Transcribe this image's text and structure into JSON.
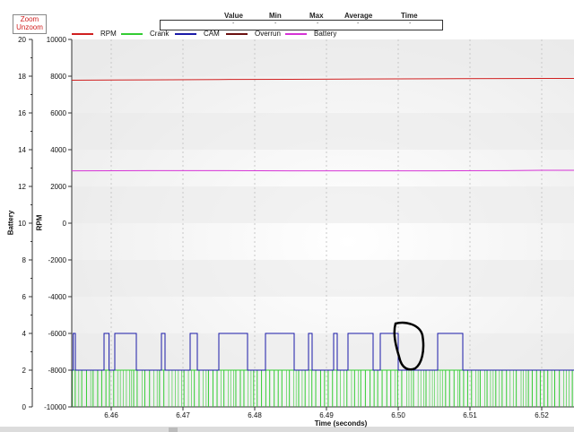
{
  "zoom": {
    "zoom_label": "Zoom",
    "unzoom_label": "Unzoom"
  },
  "stats": {
    "headers": [
      "Value",
      "Min",
      "Max",
      "Average",
      "Time"
    ],
    "values": [
      "-",
      "-",
      "-",
      "-",
      "-"
    ]
  },
  "colors": {
    "rpm": "#d02020",
    "crank": "#33cc33",
    "cam": "#1a1aa8",
    "overrun": "#6b1010",
    "battery": "#d633d6",
    "band": "#e9e9e9"
  },
  "chart_data": {
    "type": "line",
    "xlabel": "Time (seconds)",
    "y_left_label": "Battery",
    "y_right_label": "RPM",
    "xlim": [
      6.4545,
      6.5245
    ],
    "x_ticks": [
      6.46,
      6.47,
      6.48,
      6.49,
      6.5,
      6.51,
      6.52
    ],
    "battery_axis": {
      "range": [
        0,
        20
      ],
      "ticks": [
        0,
        2,
        4,
        6,
        8,
        10,
        12,
        14,
        16,
        18,
        20
      ]
    },
    "rpm_axis": {
      "range": [
        -10000,
        10000
      ],
      "ticks": [
        -10000,
        -8000,
        -6000,
        -4000,
        -2000,
        0,
        2000,
        4000,
        6000,
        8000,
        10000
      ]
    },
    "series": [
      {
        "name": "RPM",
        "values": [
          7780,
          7800,
          7820,
          7830,
          7850,
          7860,
          7870,
          7880,
          7880
        ]
      },
      {
        "name": "Crank",
        "values": "pulse train between -10000 and -8000 (RPM axis)"
      },
      {
        "name": "CAM",
        "low": -8000,
        "high": -6000,
        "high_intervals": [
          [
            6.4547,
            6.455
          ],
          [
            6.459,
            6.4597
          ],
          [
            6.4605,
            6.4635
          ],
          [
            6.467,
            6.4675
          ],
          [
            6.471,
            6.472
          ],
          [
            6.475,
            6.479
          ],
          [
            6.4815,
            6.4855
          ],
          [
            6.4875,
            6.488
          ],
          [
            6.491,
            6.4915
          ],
          [
            6.493,
            6.4965
          ],
          [
            6.4975,
            6.5
          ],
          [
            6.5055,
            6.509
          ]
        ]
      },
      {
        "name": "Overrun",
        "values": []
      },
      {
        "name": "Battery",
        "values": [
          12.85,
          12.86,
          12.86,
          12.85,
          12.85,
          12.85,
          12.86,
          12.88,
          12.88
        ]
      }
    ],
    "rpm_x": [
      6.4545,
      6.465,
      6.475,
      6.485,
      6.495,
      6.505,
      6.515,
      6.52,
      6.5245
    ],
    "legend": [
      "RPM",
      "Crank",
      "CAM",
      "Overrun",
      "Battery"
    ],
    "legend_position": "top-left",
    "grid": true
  }
}
